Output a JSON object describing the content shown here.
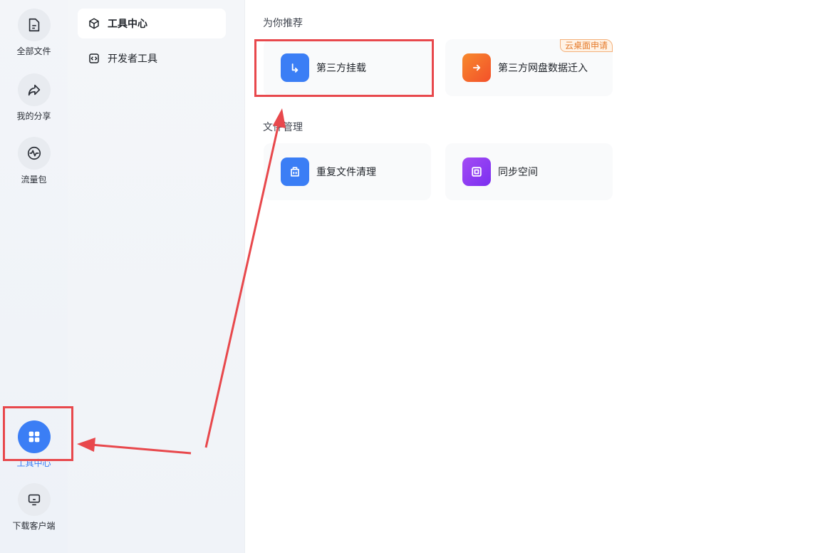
{
  "rail": {
    "items": [
      {
        "label": "全部文件",
        "icon": "file-icon"
      },
      {
        "label": "我的分享",
        "icon": "share-icon"
      },
      {
        "label": "流量包",
        "icon": "traffic-icon"
      },
      {
        "label": "工具中心",
        "icon": "grid-icon",
        "active": true
      },
      {
        "label": "下载客户端",
        "icon": "monitor-icon"
      }
    ]
  },
  "subnav": {
    "items": [
      {
        "label": "工具中心",
        "icon": "cube-icon",
        "active": true
      },
      {
        "label": "开发者工具",
        "icon": "code-icon"
      }
    ]
  },
  "sections": [
    {
      "title": "为你推荐",
      "cards": [
        {
          "label": "第三方挂载",
          "icon": "mount-icon",
          "color": "#3b7ef5"
        },
        {
          "label": "第三方网盘数据迁入",
          "icon": "migrate-icon",
          "color": "#f5622a",
          "badge": "云桌面申请"
        }
      ]
    },
    {
      "title": "文件管理",
      "cards": [
        {
          "label": "重复文件清理",
          "icon": "trash-icon",
          "color": "#3b7ef5"
        },
        {
          "label": "同步空间",
          "icon": "sync-icon",
          "color": "#8b3cf0"
        }
      ]
    }
  ],
  "colors": {
    "accent": "#3b7ef5",
    "annotation": "#e8484c"
  }
}
